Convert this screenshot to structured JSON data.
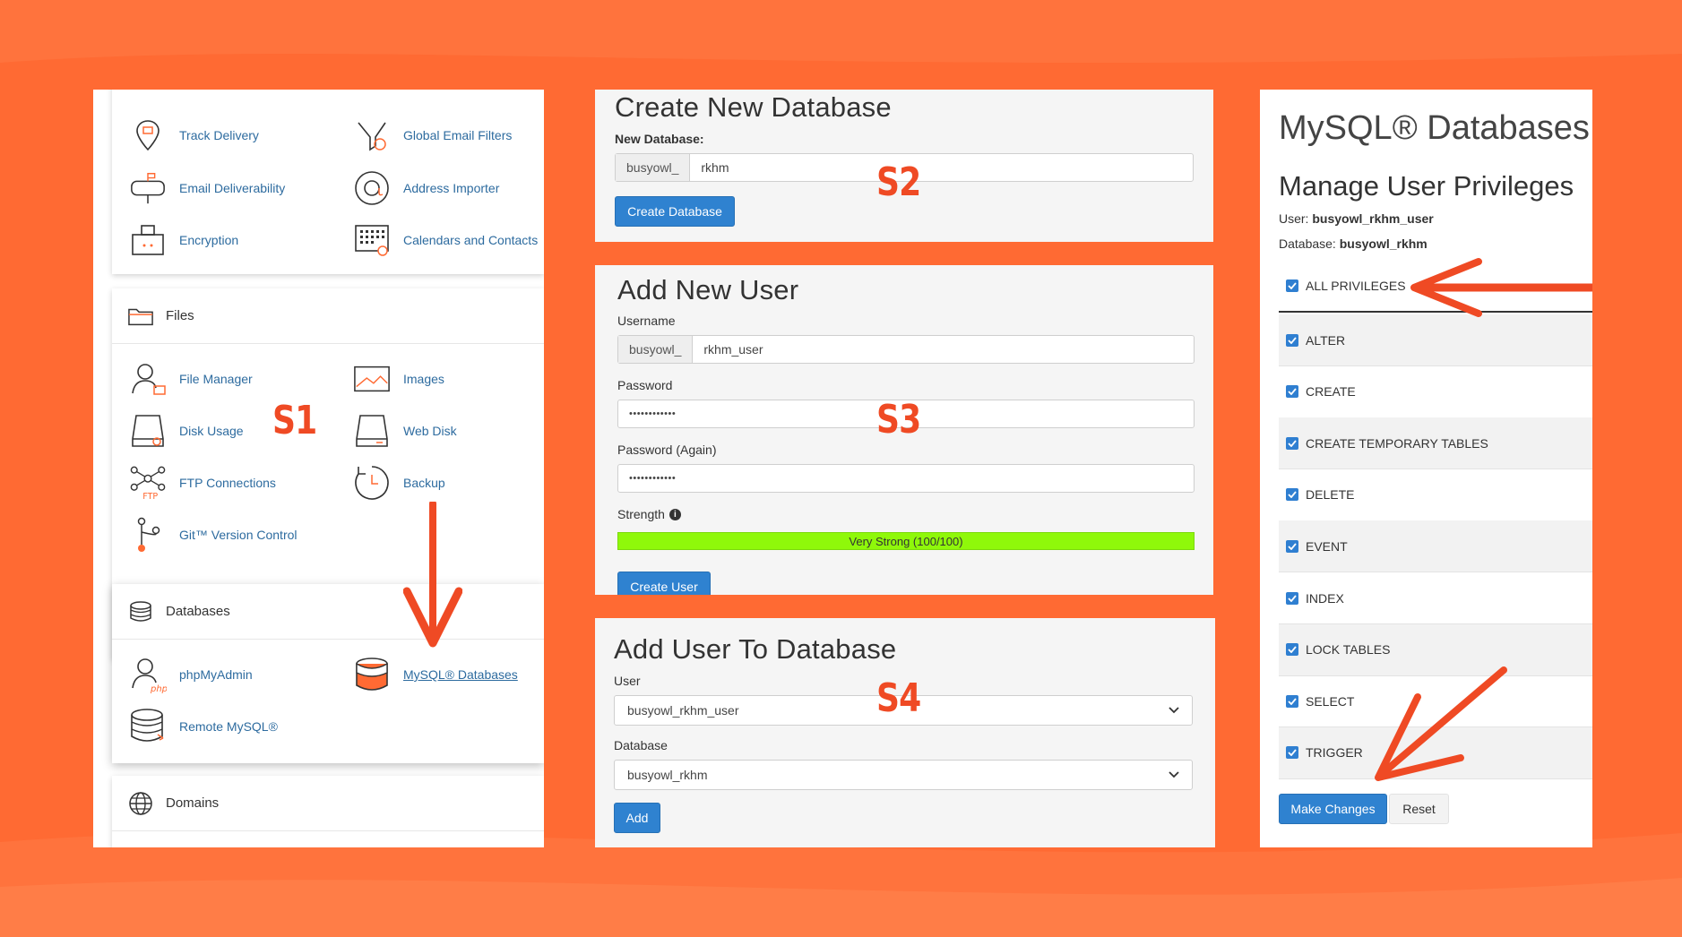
{
  "steps": {
    "s1": "S1",
    "s2": "S2",
    "s3": "S3",
    "s4": "S4"
  },
  "colors": {
    "background": "#ff6a33",
    "accent": "#ef4a24",
    "primary_button": "#2f82d0",
    "strength_bar": "#8ff80a",
    "link": "#2d6b9f"
  },
  "cpanel": {
    "email_tools": [
      {
        "label": "Track Delivery",
        "icon": "track-delivery-icon"
      },
      {
        "label": "Global Email Filters",
        "icon": "email-filter-icon"
      },
      {
        "label": "Email Deliverability",
        "icon": "mailbox-icon"
      },
      {
        "label": "Address Importer",
        "icon": "address-importer-icon"
      },
      {
        "label": "Encryption",
        "icon": "encryption-icon"
      },
      {
        "label": "Calendars and Contacts",
        "icon": "calendar-icon"
      }
    ],
    "files_section": "Files",
    "files_tools": [
      {
        "label": "File Manager",
        "icon": "file-manager-icon"
      },
      {
        "label": "Images",
        "icon": "images-icon"
      },
      {
        "label": "Disk Usage",
        "icon": "disk-usage-icon"
      },
      {
        "label": "Web Disk",
        "icon": "web-disk-icon"
      },
      {
        "label": "FTP Connections",
        "icon": "ftp-icon"
      },
      {
        "label": "Backup",
        "icon": "backup-icon"
      },
      {
        "label": "Git™ Version Control",
        "icon": "git-icon"
      }
    ],
    "databases_section": "Databases",
    "databases_tools": [
      {
        "label": "phpMyAdmin",
        "icon": "phpmyadmin-icon"
      },
      {
        "label": "MySQL® Databases",
        "icon": "mysql-database-icon"
      },
      {
        "label": "Remote MySQL®",
        "icon": "remote-mysql-icon"
      }
    ],
    "domains_section": "Domains"
  },
  "create_db": {
    "title": "Create New Database",
    "label": "New Database:",
    "prefix": "busyowl_",
    "value": "rkhm",
    "button": "Create Database"
  },
  "add_user": {
    "title": "Add New User",
    "username_label": "Username",
    "prefix": "busyowl_",
    "username_value": "rkhm_user",
    "password_label": "Password",
    "password_value": "••••••••••••",
    "password_again_label": "Password (Again)",
    "password_again_value": "••••••••••••",
    "strength_label": "Strength",
    "strength_text": "Very Strong (100/100)",
    "strength_percent": 100,
    "button": "Create User"
  },
  "add_to_db": {
    "title": "Add User To Database",
    "user_label": "User",
    "user_value": "busyowl_rkhm_user",
    "database_label": "Database",
    "database_value": "busyowl_rkhm",
    "button": "Add"
  },
  "privileges": {
    "app_title": "MySQL® Databases",
    "title": "Manage User Privileges",
    "user_label": "User:",
    "user_value": "busyowl_rkhm_user",
    "database_label": "Database:",
    "database_value": "busyowl_rkhm",
    "all_label": "ALL PRIVILEGES",
    "items": [
      "ALTER",
      "CREATE",
      "CREATE TEMPORARY TABLES",
      "DELETE",
      "EVENT",
      "INDEX",
      "LOCK TABLES",
      "SELECT",
      "TRIGGER"
    ],
    "make_changes": "Make Changes",
    "reset": "Reset"
  }
}
